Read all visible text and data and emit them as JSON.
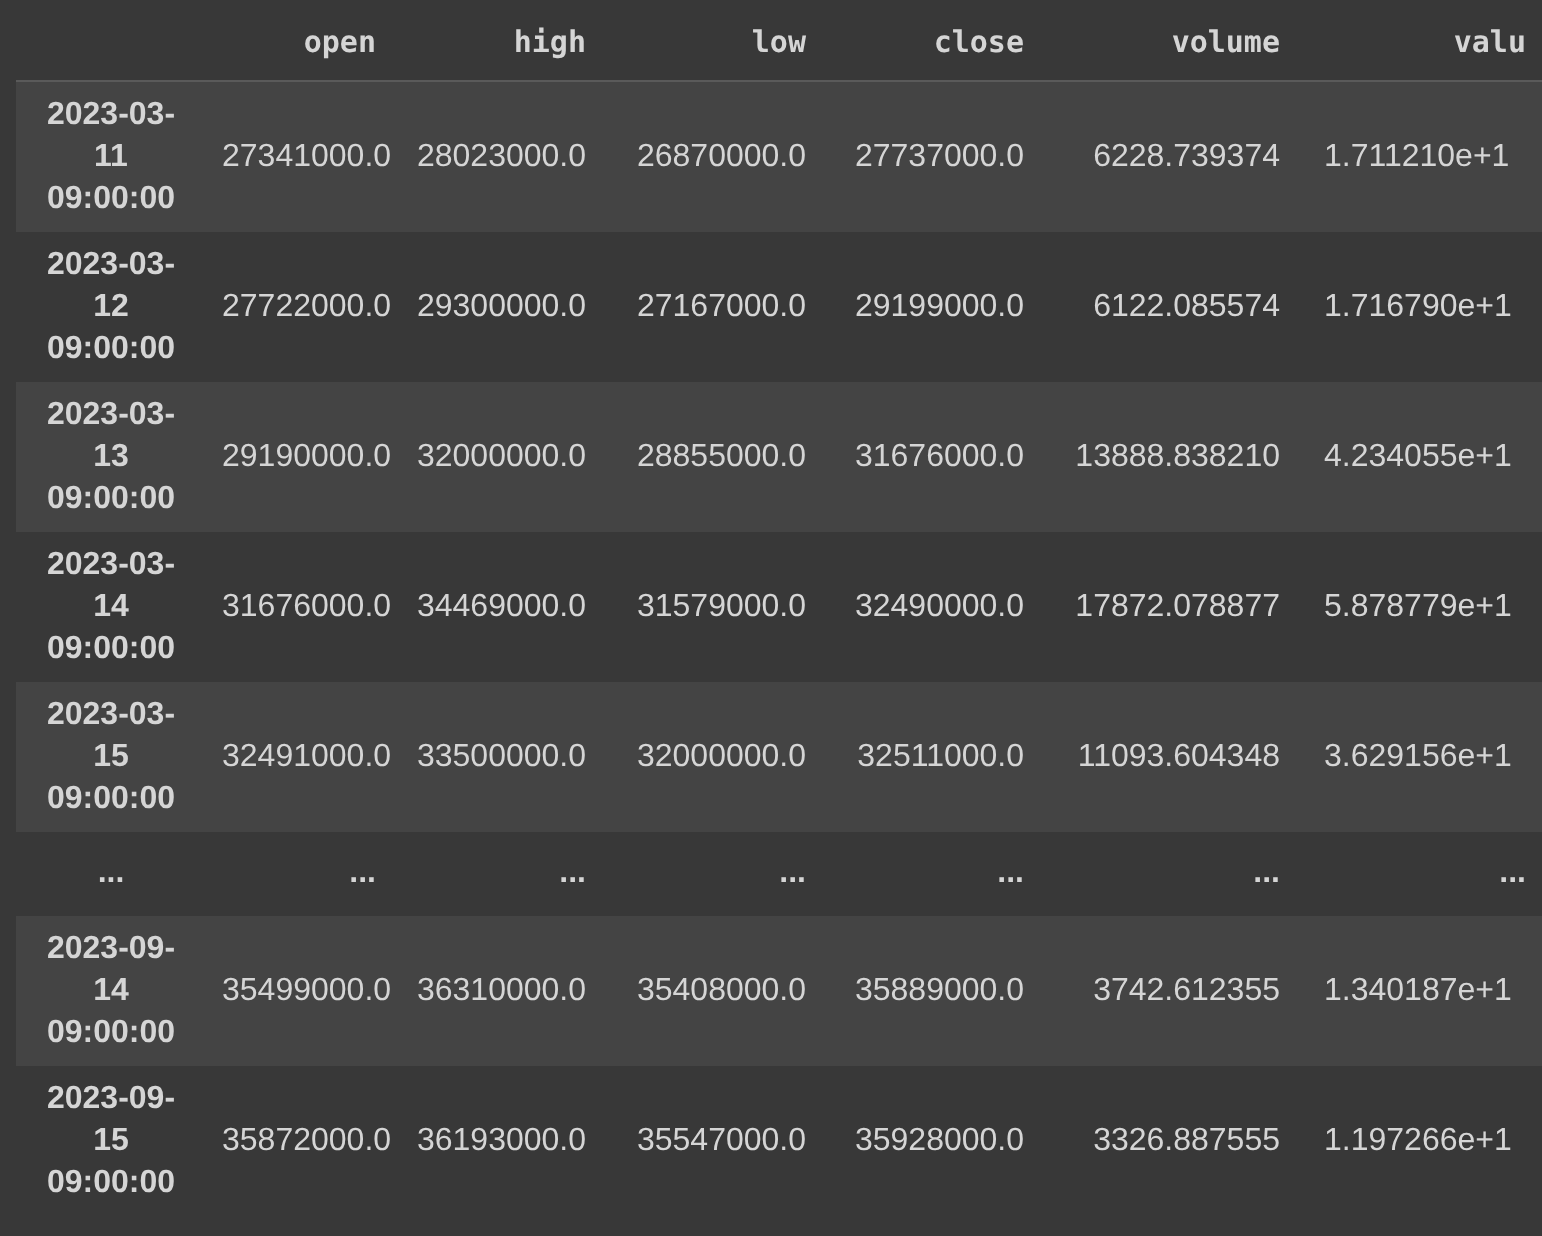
{
  "table": {
    "columns": [
      "open",
      "high",
      "low",
      "close",
      "volume",
      "valu"
    ],
    "rows": [
      {
        "index": "2023-03-11 09:00:00",
        "cells": [
          "27341000.0",
          "28023000.0",
          "26870000.0",
          "27737000.0",
          "6228.739374",
          "1.711210e+1"
        ]
      },
      {
        "index": "2023-03-12 09:00:00",
        "cells": [
          "27722000.0",
          "29300000.0",
          "27167000.0",
          "29199000.0",
          "6122.085574",
          "1.716790e+1"
        ]
      },
      {
        "index": "2023-03-13 09:00:00",
        "cells": [
          "29190000.0",
          "32000000.0",
          "28855000.0",
          "31676000.0",
          "13888.838210",
          "4.234055e+1"
        ]
      },
      {
        "index": "2023-03-14 09:00:00",
        "cells": [
          "31676000.0",
          "34469000.0",
          "31579000.0",
          "32490000.0",
          "17872.078877",
          "5.878779e+1"
        ]
      },
      {
        "index": "2023-03-15 09:00:00",
        "cells": [
          "32491000.0",
          "33500000.0",
          "32000000.0",
          "32511000.0",
          "11093.604348",
          "3.629156e+1"
        ]
      },
      {
        "index": "...",
        "cells": [
          "...",
          "...",
          "...",
          "...",
          "...",
          "..."
        ]
      },
      {
        "index": "2023-09-14 09:00:00",
        "cells": [
          "35499000.0",
          "36310000.0",
          "35408000.0",
          "35889000.0",
          "3742.612355",
          "1.340187e+1"
        ]
      },
      {
        "index": "2023-09-15 09:00:00",
        "cells": [
          "35872000.0",
          "36193000.0",
          "35547000.0",
          "35928000.0",
          "3326.887555",
          "1.197266e+1"
        ]
      }
    ]
  }
}
